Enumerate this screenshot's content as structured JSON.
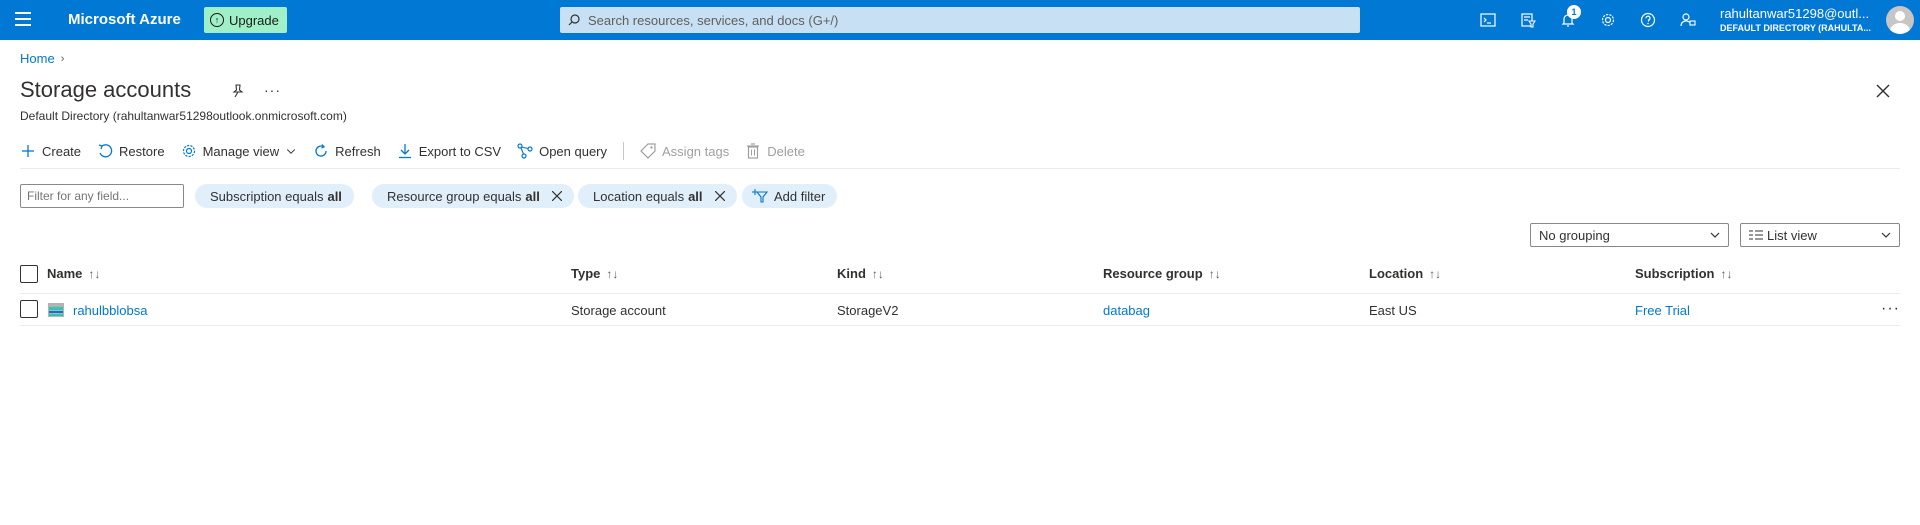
{
  "topbar": {
    "brand": "Microsoft Azure",
    "upgrade_label": "Upgrade",
    "search_placeholder": "Search resources, services, and docs (G+/)",
    "notification_count": "1",
    "account_email": "rahultanwar51298@outl...",
    "account_directory": "DEFAULT DIRECTORY (RAHULTA..."
  },
  "breadcrumb": {
    "home": "Home"
  },
  "header": {
    "title": "Storage accounts",
    "subtitle": "Default Directory (rahultanwar51298outlook.onmicrosoft.com)"
  },
  "toolbar": {
    "create": "Create",
    "restore": "Restore",
    "manage_view": "Manage view",
    "refresh": "Refresh",
    "export_csv": "Export to CSV",
    "open_query": "Open query",
    "assign_tags": "Assign tags",
    "delete": "Delete"
  },
  "filters": {
    "placeholder": "Filter for any field...",
    "subscription_prefix": "Subscription equals",
    "subscription_value": "all",
    "resource_group_prefix": "Resource group equals",
    "resource_group_value": "all",
    "location_prefix": "Location equals",
    "location_value": "all",
    "add_filter": "Add filter"
  },
  "view": {
    "grouping": "No grouping",
    "view_mode": "List view"
  },
  "table": {
    "columns": {
      "name": "Name",
      "type": "Type",
      "kind": "Kind",
      "resource_group": "Resource group",
      "location": "Location",
      "subscription": "Subscription"
    },
    "rows": [
      {
        "name": "rahulbblobsa",
        "type": "Storage account",
        "kind": "StorageV2",
        "resource_group": "databag",
        "location": "East US",
        "subscription": "Free Trial"
      }
    ]
  },
  "icons": {
    "menu": "hamburger-icon",
    "search": "search-icon",
    "cloud_shell": "cloud-shell-icon",
    "directory": "directory-filter-icon",
    "notifications": "bell-icon",
    "settings": "gear-icon",
    "help": "help-icon",
    "feedback": "feedback-icon"
  },
  "colors": {
    "brand_blue": "#0078d4",
    "upgrade_green": "#9ff0c8",
    "search_bg": "#c7e0f4",
    "pill_bg": "#e1effa"
  }
}
